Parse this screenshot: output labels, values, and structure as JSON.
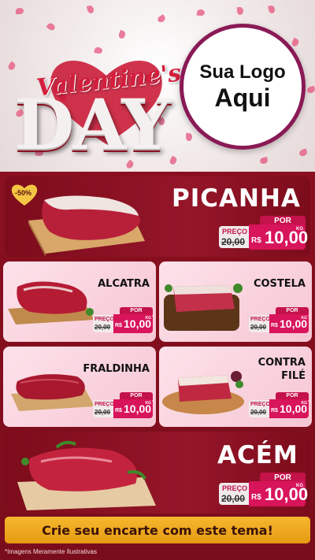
{
  "header": {
    "title_script": "Valentine's",
    "title_big": "DAY",
    "logo": {
      "line1": "Sua Logo",
      "line2": "Aqui"
    }
  },
  "featured_badge": "-50%",
  "products": [
    {
      "id": "picanha",
      "name": "PICANHA",
      "price_label": "PREÇO",
      "por_label": "POR",
      "old_price": "20,00",
      "currency": "R$",
      "new_price": "10,00",
      "unit": "KG"
    },
    {
      "id": "alcatra",
      "name": "ALCATRA",
      "price_label": "PREÇO",
      "por_label": "POR",
      "old_price": "20,00",
      "currency": "R$",
      "new_price": "10,00",
      "unit": "KG"
    },
    {
      "id": "costela",
      "name": "COSTELA",
      "price_label": "PREÇO",
      "por_label": "POR",
      "old_price": "20,00",
      "currency": "R$",
      "new_price": "10,00",
      "unit": "KG"
    },
    {
      "id": "fraldinha",
      "name": "FRALDINHA",
      "price_label": "PREÇO",
      "por_label": "POR",
      "old_price": "20,00",
      "currency": "R$",
      "new_price": "10,00",
      "unit": "KG"
    },
    {
      "id": "contrafile",
      "name_line1": "CONTRA",
      "name_line2": "FILÉ",
      "price_label": "PREÇO",
      "por_label": "POR",
      "old_price": "20,00",
      "currency": "R$",
      "new_price": "10,00",
      "unit": "KG"
    },
    {
      "id": "acem",
      "name": "ACÉM",
      "price_label": "PREÇO",
      "por_label": "POR",
      "old_price": "20,00",
      "currency": "R$",
      "new_price": "10,00",
      "unit": "KG"
    }
  ],
  "cta": "Crie seu encarte com este tema!",
  "footnote": "*Imagens Meramente Ilustrativas",
  "colors": {
    "wine": "#8a1020",
    "pink_tag": "#d8145a",
    "cta_gold": "#f0ab1f",
    "logo_border": "#8a1a56"
  }
}
